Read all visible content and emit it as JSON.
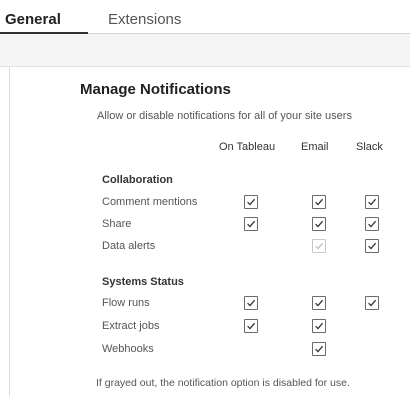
{
  "tabs": [
    {
      "label": "General",
      "active": true
    },
    {
      "label": "Extensions",
      "active": false
    }
  ],
  "panel": {
    "title": "Manage Notifications",
    "subtitle": "Allow or disable notifications for all of your site users",
    "footer": "If grayed out, the notification option is disabled for use."
  },
  "columns": [
    "On Tableau",
    "Email",
    "Slack"
  ],
  "sections": [
    {
      "name": "Collaboration",
      "rows": [
        {
          "label": "Comment mentions",
          "channels": [
            {
              "state": "checked"
            },
            {
              "state": "checked"
            },
            {
              "state": "checked"
            }
          ]
        },
        {
          "label": "Share",
          "channels": [
            {
              "state": "checked"
            },
            {
              "state": "checked"
            },
            {
              "state": "checked"
            }
          ]
        },
        {
          "label": "Data alerts",
          "channels": [
            {
              "state": "none"
            },
            {
              "state": "checked-disabled"
            },
            {
              "state": "checked"
            }
          ]
        }
      ]
    },
    {
      "name": "Systems Status",
      "rows": [
        {
          "label": "Flow runs",
          "channels": [
            {
              "state": "checked"
            },
            {
              "state": "checked"
            },
            {
              "state": "checked"
            }
          ]
        },
        {
          "label": "Extract jobs",
          "channels": [
            {
              "state": "checked"
            },
            {
              "state": "checked"
            },
            {
              "state": "none"
            }
          ]
        },
        {
          "label": "Webhooks",
          "channels": [
            {
              "state": "none"
            },
            {
              "state": "checked"
            },
            {
              "state": "none"
            }
          ]
        }
      ]
    }
  ],
  "colors": {
    "checkmark": "#333333",
    "checkmark_disabled": "#c0c0c0"
  }
}
